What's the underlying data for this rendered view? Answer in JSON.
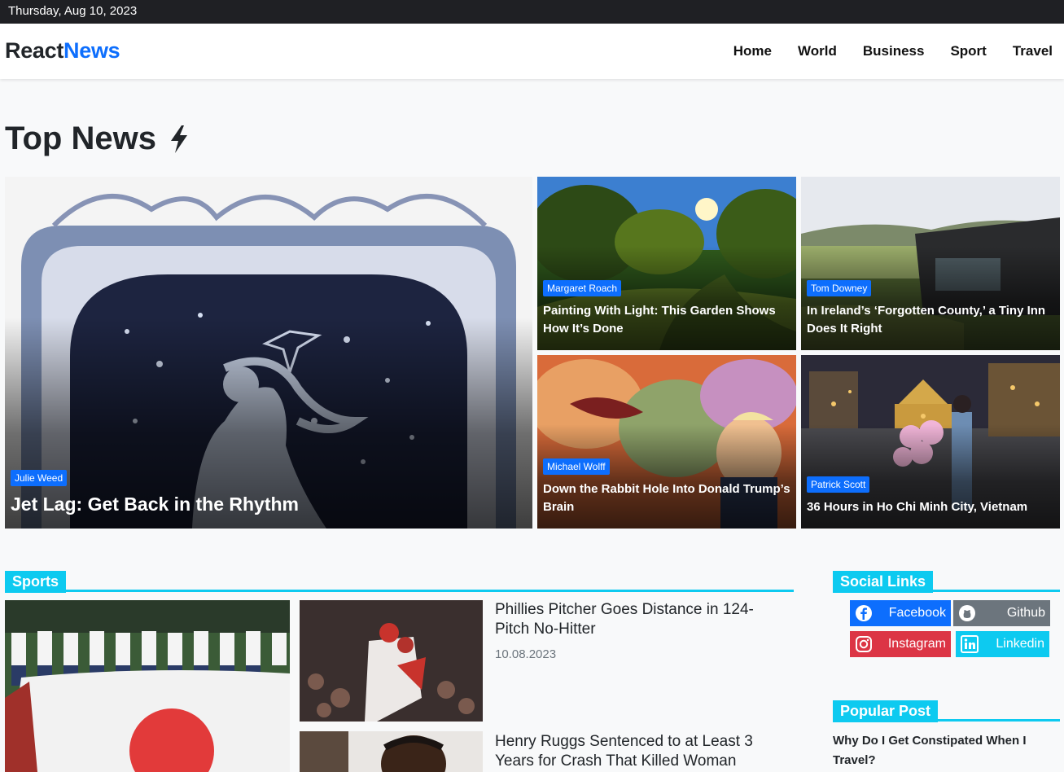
{
  "topbar": {
    "date": "Thursday, Aug 10, 2023"
  },
  "brand": {
    "part1": "React",
    "part2": "News"
  },
  "nav": [
    "Home",
    "World",
    "Business",
    "Sport",
    "Travel"
  ],
  "top_news": {
    "heading": "Top News",
    "icon": "lightning-bolt-icon",
    "featured": {
      "author": "Julie Weed",
      "title": "Jet Lag: Get Back in the Rhythm"
    },
    "cards": [
      {
        "author": "Margaret Roach",
        "title": "Painting With Light: This Garden Shows How It’s Done"
      },
      {
        "author": "Tom Downey",
        "title": "In Ireland’s ‘Forgotten County,’ a Tiny Inn Does It Right"
      },
      {
        "author": "Michael Wolff",
        "title": "Down the Rabbit Hole Into Donald Trump’s Brain"
      },
      {
        "author": "Patrick Scott",
        "title": "36 Hours in Ho Chi Minh City, Vietnam"
      }
    ]
  },
  "sports": {
    "heading": "Sports",
    "posts": [
      {
        "title": "Phillies Pitcher Goes Distance in 124-Pitch No-Hitter",
        "date": "10.08.2023"
      },
      {
        "title": "Henry Ruggs Sentenced to at Least 3 Years for Crash That Killed Woman",
        "date": ""
      }
    ]
  },
  "social": {
    "heading": "Social Links",
    "links": [
      {
        "label": "Facebook",
        "icon": "facebook-icon",
        "color": "#0d6efd"
      },
      {
        "label": "Github",
        "icon": "github-icon",
        "color": "#6c757d"
      },
      {
        "label": "Instagram",
        "icon": "instagram-icon",
        "color": "#dc3545"
      },
      {
        "label": "Linkedin",
        "icon": "linkedin-icon",
        "color": "#0dcaf0"
      }
    ]
  },
  "popular": {
    "heading": "Popular Post",
    "posts": [
      {
        "title": "Why Do I Get Constipated When I Travel?"
      }
    ]
  },
  "colors": {
    "accent": "#0d6efd",
    "section": "#0dcaf0",
    "topbar": "#1f2024"
  }
}
